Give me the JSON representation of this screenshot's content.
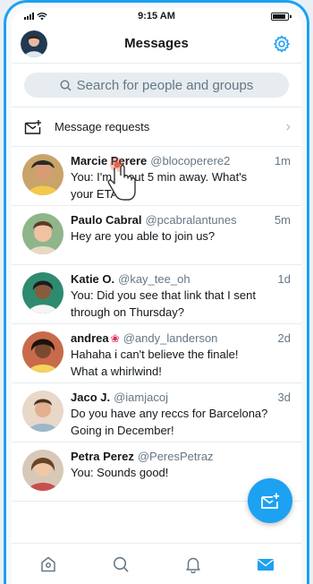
{
  "status_bar": {
    "time": "9:15 AM",
    "battery_level": 0.9
  },
  "header": {
    "title": "Messages",
    "avatar_icon": "user-avatar",
    "settings_icon": "gear-icon"
  },
  "search": {
    "placeholder": "Search for people and groups"
  },
  "requests": {
    "label": "Message requests",
    "icon": "envelope-plus-icon"
  },
  "conversations": [
    {
      "name": "Marcie Perere",
      "handle": "@blocoperere2",
      "time": "1m",
      "text": "You: I'm about 5 min away. What's\nyour ETA?"
    },
    {
      "name": "Paulo Cabral",
      "handle": "@pcabralantunes",
      "time": "5m",
      "text": "Hey are you able to join us?"
    },
    {
      "name": "Katie O.",
      "handle": "@kay_tee_oh",
      "time": "1d",
      "text": "You: Did you see that link that I sent\nthrough on Thursday?"
    },
    {
      "name": "andrea",
      "handle": "@andy_landerson",
      "time": "2d",
      "text": "Hahaha i can't believe the finale!\nWhat a whirlwind!",
      "badge": "❀"
    },
    {
      "name": "Jaco J.",
      "handle": "@iamjacoj",
      "time": "3d",
      "text": "Do you have any reccs for Barcelona?\nGoing in December!"
    },
    {
      "name": "Petra Perez",
      "handle": "@PeresPetraz",
      "time": "",
      "text": "You: Sounds good!"
    }
  ],
  "tabs": [
    {
      "icon": "home-icon"
    },
    {
      "icon": "search-icon"
    },
    {
      "icon": "bell-icon"
    },
    {
      "icon": "mail-icon",
      "active": true
    }
  ],
  "fab": {
    "icon": "new-message-icon"
  },
  "colors": {
    "accent": "#1da1f2",
    "muted": "#657786",
    "divider": "#e6ecf0"
  }
}
